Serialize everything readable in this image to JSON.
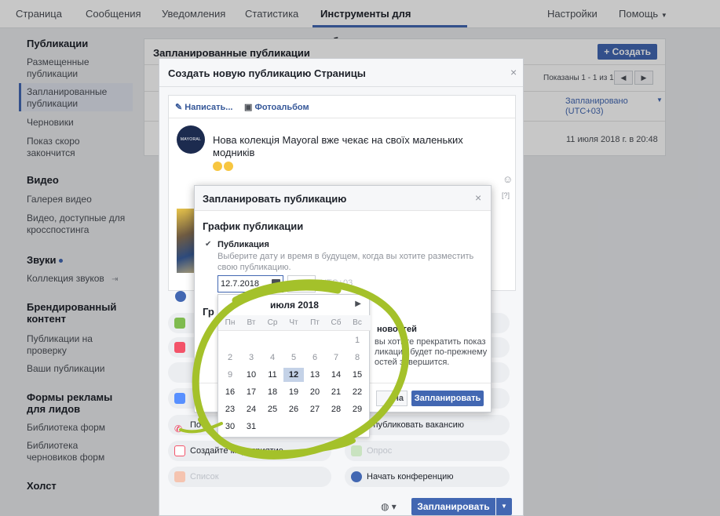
{
  "topnav": {
    "tabs": [
      "Страница",
      "Сообщения",
      "Уведомления",
      "Статистика",
      "Инструменты для публикации"
    ],
    "settings": "Настройки",
    "help": "Помощь"
  },
  "sidebar": {
    "publications": {
      "heading": "Публикации",
      "items": [
        "Размещенные публикации",
        "Запланированные публикации",
        "Черновики",
        "Показ скоро закончится"
      ]
    },
    "video": {
      "heading": "Видео",
      "items": [
        "Галерея видео",
        "Видео, доступные для кросспостинга"
      ]
    },
    "sounds": {
      "heading": "Звуки",
      "items": [
        "Коллекция звуков"
      ]
    },
    "branded": {
      "heading": "Брендированный контент",
      "items": [
        "Публикации на проверку",
        "Ваши публикации"
      ]
    },
    "leadforms": {
      "heading": "Формы рекламы для лидов",
      "items": [
        "Библиотека форм",
        "Библиотека черновиков форм"
      ]
    },
    "canvas": {
      "heading": "Холст"
    }
  },
  "panel": {
    "title": "Запланированные публикации",
    "create_label": "+ Создать",
    "pager_text": "Показаны 1 - 1 из 1",
    "col_header": "Запланировано (UTC+03)",
    "row_date": "11 июля 2018 г. в 20:48"
  },
  "compose": {
    "title": "Создать новую публикацию Страницы",
    "tab_write": "Написать...",
    "tab_album": "Фотоальбом",
    "avatar_text": "MAYORAL",
    "post_text": "Нова колекція Mayoral вже чекає на своїх маленьких модників",
    "help_mark": "[?]",
    "options": {
      "create_event": "Создайте мероприятие",
      "poll": "Опрос",
      "list": "Список",
      "start_conference": "Начать конференцию",
      "publish_job": "Опубликовать вакансию",
      "partial_left": "По"
    },
    "schedule_btn": "Запланировать"
  },
  "schedule_dialog": {
    "title": "Запланировать публикацию",
    "section_title": "График публикации",
    "publication_label": "Публикация",
    "publication_desc": "Выберите дату и время в будущем, когда вы хотите разместить свою публикацию.",
    "date_value": "12.7.2018",
    "timezone": "UTC+03",
    "partial_heading": "Гр",
    "partial_news": "новостей",
    "partial_line1": "вы хотите прекратить показ",
    "partial_line2": "ликация будет по-прежнему",
    "partial_line3": "остей завершится.",
    "cancel_label": "ена",
    "confirm_label": "Запланировать"
  },
  "calendar": {
    "month": "июля 2018",
    "weekdays": [
      "Пн",
      "Вт",
      "Ср",
      "Чт",
      "Пт",
      "Сб",
      "Вс"
    ],
    "weeks": [
      [
        "",
        "",
        "",
        "",
        "",
        "",
        "1"
      ],
      [
        "2",
        "3",
        "4",
        "5",
        "6",
        "7",
        "8"
      ],
      [
        "9",
        "10",
        "11",
        "12",
        "13",
        "14",
        "15"
      ],
      [
        "16",
        "17",
        "18",
        "19",
        "20",
        "21",
        "22"
      ],
      [
        "23",
        "24",
        "25",
        "26",
        "27",
        "28",
        "29"
      ],
      [
        "30",
        "31",
        "",
        "",
        "",
        "",
        ""
      ]
    ],
    "selected_day": "12",
    "last_past_day": 9
  },
  "colors": {
    "accent": "#4267b2",
    "highlight_ring": "#a4c12a"
  }
}
